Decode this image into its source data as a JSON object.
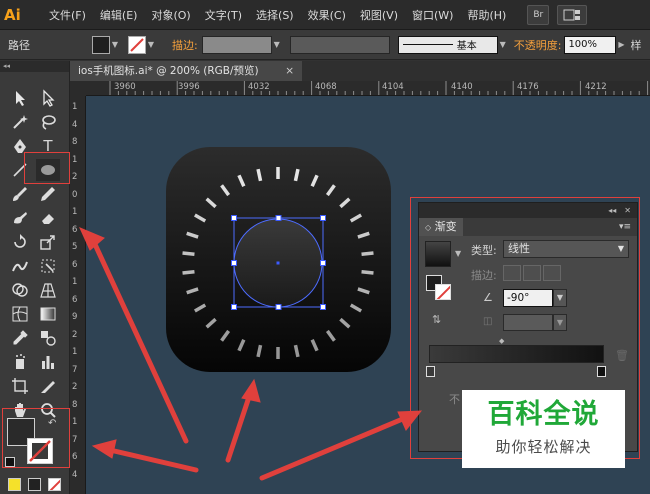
{
  "app": {
    "logo": "Ai"
  },
  "menu": [
    "文件(F)",
    "编辑(E)",
    "对象(O)",
    "文字(T)",
    "选择(S)",
    "效果(C)",
    "视图(V)",
    "窗口(W)",
    "帮助(H)"
  ],
  "top_buttons": {
    "bridge": "Br"
  },
  "control_bar": {
    "mode_label": "路径",
    "stroke_label": "描边:",
    "brush_preset": "基本",
    "opacity_label": "不透明度:",
    "opacity_value": "100%",
    "style_label": "样"
  },
  "document_tab": {
    "title": "ios手机图标.ai* @ 200% (RGB/预览)",
    "close": "×"
  },
  "ruler": {
    "top_labels": [
      "3960",
      "3996",
      "4032",
      "4068",
      "4104",
      "4140",
      "4176",
      "4212"
    ],
    "left_labels": [
      "1",
      "4",
      "8",
      "1",
      "2",
      "0",
      "1",
      "6",
      "5",
      "6",
      "1",
      "6",
      "9",
      "2",
      "1",
      "7",
      "2",
      "8",
      "1",
      "7",
      "6",
      "4"
    ]
  },
  "gradient_panel": {
    "tab_title": "渐变",
    "type_label": "类型:",
    "type_value": "线性",
    "stroke_label": "描边:",
    "angle_value": "-90°",
    "footer_text": "不"
  },
  "colors": {
    "accent_orange": "#f7a11a",
    "canvas_bg": "#2f4354",
    "annotation_red": "#e0403c",
    "watermark_green": "#20a838"
  },
  "watermark": {
    "title": "百科全说",
    "subtitle": "助你轻松解决"
  }
}
